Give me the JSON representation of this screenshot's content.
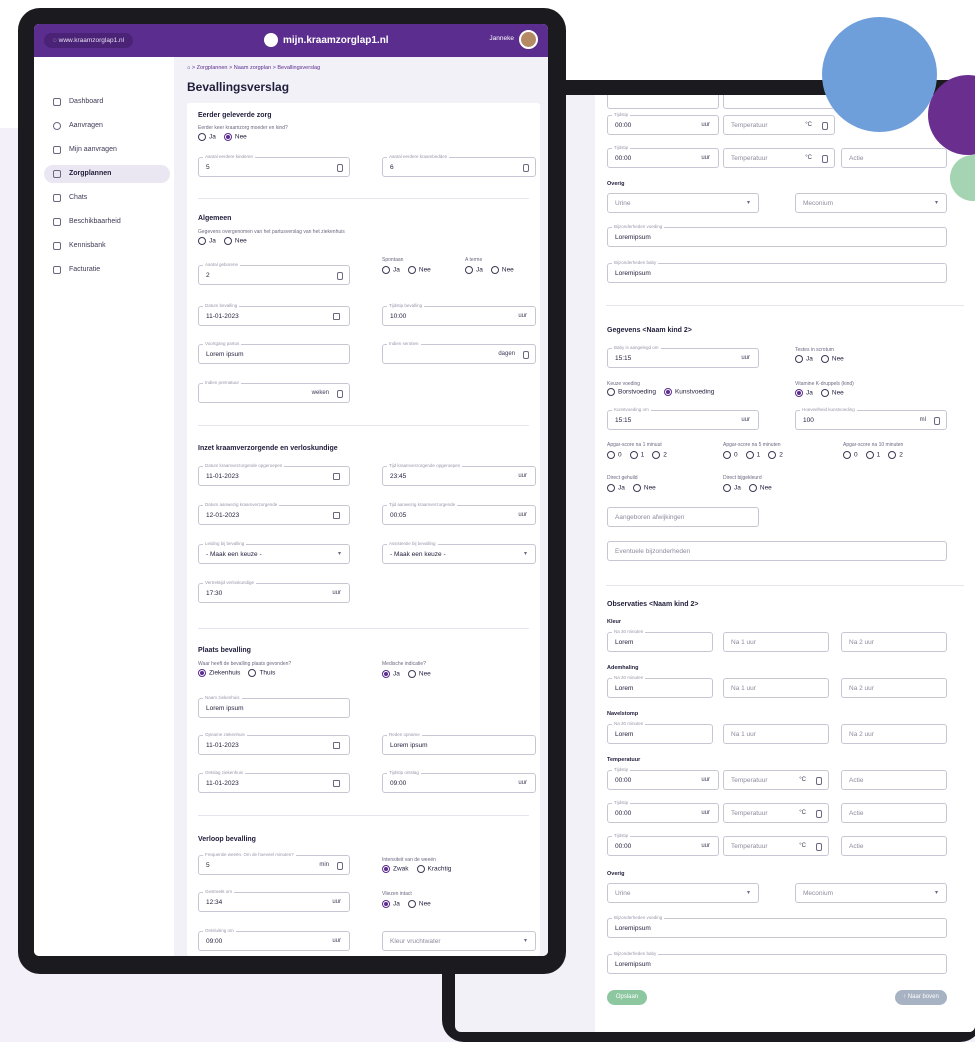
{
  "colors": {
    "brand": "#5b2d8e",
    "accent_green": "#8cc7a0",
    "circle_blue": "#6f9fdb",
    "circle_purple": "#6a2e8f"
  },
  "front": {
    "topbar": {
      "url": "www.kraamzorglap1.nl",
      "brand": "mijn.kraamzorglap1.nl",
      "user": "Janneke"
    },
    "sidebar": [
      {
        "label": "Dashboard",
        "icon": "home-icon",
        "active": false
      },
      {
        "label": "Aanvragen",
        "icon": "search-icon",
        "active": false
      },
      {
        "label": "Mijn aanvragen",
        "icon": "grid-icon",
        "active": false
      },
      {
        "label": "Zorgplannen",
        "icon": "list-icon",
        "active": true
      },
      {
        "label": "Chats",
        "icon": "chat-icon",
        "active": false
      },
      {
        "label": "Beschikbaarheid",
        "icon": "calendar-icon",
        "active": false
      },
      {
        "label": "Kennisbank",
        "icon": "book-icon",
        "active": false
      },
      {
        "label": "Facturatie",
        "icon": "invoice-icon",
        "active": false
      }
    ],
    "breadcrumb": {
      "c1": "Zorgplannen",
      "c2": "Naam zorgplan",
      "c3": "Bevallingsverslag",
      "sep": ">"
    },
    "title": "Bevallingsverslag",
    "s1": {
      "title": "Eerder geleverde zorg",
      "q": "Eerder keer kraamzorg moeder en kind?",
      "ja": "Ja",
      "nee": "Nee",
      "f1": {
        "label": "Aantal eerdere kinderen",
        "value": "5"
      },
      "f2": {
        "label": "Aantal eerdere kraambedden",
        "value": "6"
      }
    },
    "s2": {
      "title": "Algemeen",
      "q": "Gegevens overgenomen van het partusverslag van het ziekenhuis",
      "ja": "Ja",
      "nee": "Nee",
      "f1": {
        "label": "Aantal geborene",
        "value": "2"
      },
      "q2": "Spontaan",
      "q3": "A terme",
      "f2": {
        "label": "Datum bevalling",
        "value": "11-01-2023"
      },
      "f3": {
        "label": "Tijdstip bevalling",
        "value": "10:00",
        "unit": "uur"
      },
      "f4": {
        "label": "Voortgang partus",
        "value": "Lorem ipsum"
      },
      "f5": {
        "label": "Indien serotien",
        "unit": "dagen"
      },
      "f6": {
        "label": "Indien prematuur",
        "unit": "weken"
      }
    },
    "s3": {
      "title": "Inzet kraamverzorgende en verloskundige",
      "f1": {
        "label": "Datum kraamverzorgende opgeroepen",
        "value": "11-01-2023"
      },
      "f2": {
        "label": "Tijd kraamverzorgende opgeroepen",
        "value": "23:45",
        "unit": "uur"
      },
      "f3": {
        "label": "Datum aanwezig kraamverzorgende",
        "value": "12-01-2023"
      },
      "f4": {
        "label": "Tijd aanwezig kraamverzorgende",
        "value": "00:05",
        "unit": "uur"
      },
      "f5": {
        "label": "Leiding bij bevalling",
        "value": "- Maak een keuze -"
      },
      "f6": {
        "label": "Assistentie bij bevalling",
        "value": "- Maak een keuze -"
      },
      "f7": {
        "label": "Vertrektijd verloskundige",
        "value": "17:30",
        "unit": "uur"
      }
    },
    "s4": {
      "title": "Plaats bevalling",
      "q1": "Waar heeft de bevalling plaats gevonden?",
      "o1": "Ziekenhuis",
      "o2": "Thuis",
      "q2": "Medische indicatie?",
      "ja": "Ja",
      "nee": "Nee",
      "f1": {
        "label": "Naam ziekenhuis",
        "value": "Lorem ipsum"
      },
      "f2": {
        "label": "Opname ziekenhuis",
        "value": "11-01-2023"
      },
      "f3": {
        "label": "Reden opname",
        "value": "Lorem ipsum"
      },
      "f4": {
        "label": "Ontslag ziekenhuis",
        "value": "11-01-2023"
      },
      "f5": {
        "label": "Tijdstip ontslag",
        "value": "09:00",
        "unit": "uur"
      }
    },
    "s5": {
      "title": "Verloop bevalling",
      "f1": {
        "label": "Frequentie weeën. Om de hoeveel minuten?",
        "value": "5",
        "unit": "min"
      },
      "q1": "Intensiteit van de weeën",
      "o1": "Zwak",
      "o2": "Krachtig",
      "f2": {
        "label": "Gestreekt om",
        "value": "12:34",
        "unit": "uur"
      },
      "q2": "Vliezen intact",
      "ja": "Ja",
      "nee": "Nee",
      "f3": {
        "label": "Ontsluiting om",
        "value": "09:00",
        "unit": "uur"
      },
      "f4": {
        "placeholder": "Kleur vruchtwater"
      }
    }
  },
  "back": {
    "top": {
      "label": "Tijdstip",
      "time": "00:00",
      "unit": "uur",
      "temp": "Temperatuur",
      "temp_unit": "°C",
      "actie": "Actie"
    },
    "overig": {
      "title": "Overig",
      "urine": "Urine",
      "meconium": "Meconium",
      "voeding_label": "Bijzonderheden voeding",
      "voeding": "Loremipsum",
      "baby_label": "Bijzonderheden baby",
      "baby": "Loremipsum"
    },
    "gegevens": {
      "title": "Gegevens <Naam kind 2>",
      "f1": {
        "label": "Baby is aangelegd om",
        "value": "15:15",
        "unit": "uur"
      },
      "q1": "Testes in scrotum",
      "ja": "Ja",
      "nee": "Nee",
      "q2": "Keuze voeding",
      "o1": "Borstvoeding",
      "o2": "Kunstvoeding",
      "q3": "Vitamine K-druppels (kind)",
      "f2": {
        "label": "Kunstvoeding om",
        "value": "15:15",
        "unit": "uur"
      },
      "f3": {
        "label": "Hoeveelheid kunstvoeding",
        "value": "100",
        "unit": "ml"
      },
      "a1": "Apgar-score na 1 minuut",
      "a5": "Apgar-score na 5 minuten",
      "a10": "Apgar-score na 10 minuten",
      "s0": "0",
      "s1": "1",
      "s2": "2",
      "q4": "Direct gehuild",
      "q5": "Direct bijgekleurd",
      "p1": "Aangeboren afwijkingen",
      "p2": "Eventuele bijzonderheden"
    },
    "obs": {
      "title": "Observaties <Naam kind 2>",
      "kleur": "Kleur",
      "adem": "Ademhaling",
      "navel": "Navelstomp",
      "temperatuur": "Temperatuur",
      "l30": "Na 30 minuten",
      "v30": "Lorem",
      "p1": "Na 1 uur",
      "p2": "Na 2 uur"
    },
    "buttons": {
      "save": "Opslaan",
      "top": "↑ Naar boven"
    }
  }
}
